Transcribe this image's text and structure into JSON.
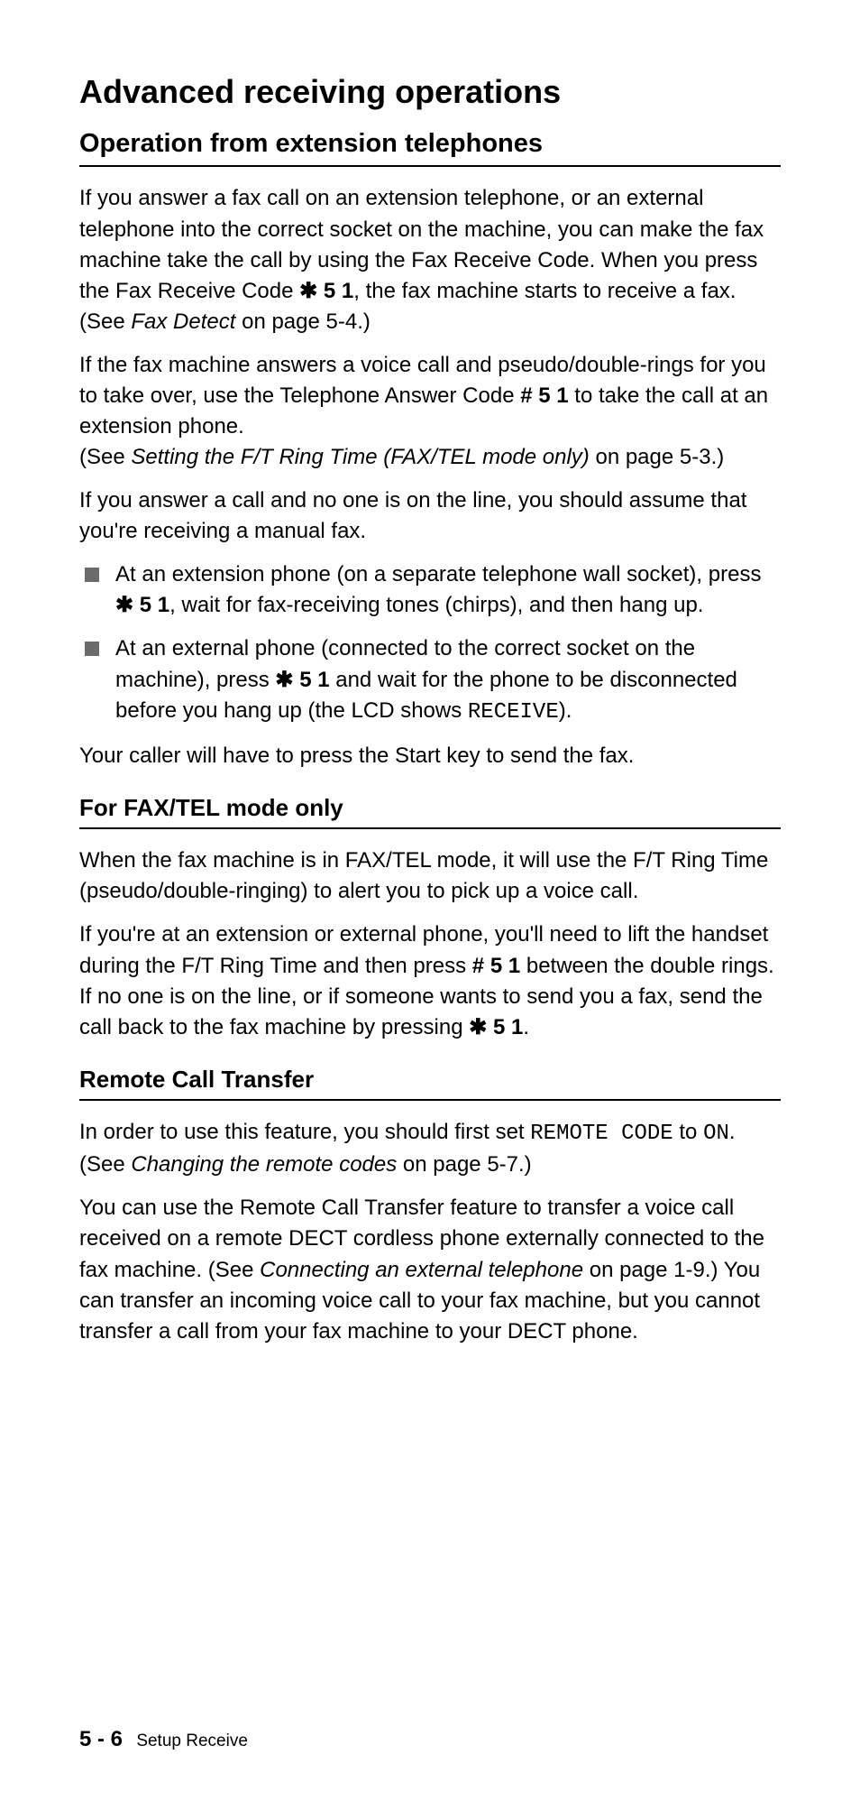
{
  "h1": "Advanced receiving operations",
  "sec1": {
    "title": "Operation from extension telephones",
    "p1a": "If you answer a fax call on an extension telephone, or an external telephone into the correct socket on the machine, you can make the fax machine take the call by using the Fax Receive Code. When you press the Fax Receive Code ",
    "code51": "5 1",
    "p1b": ", the fax machine starts to receive a fax. (See ",
    "p1ref": "Fax Detect",
    "p1c": " on page 5-4.)",
    "p2a": "If the fax machine answers a voice call and pseudo/double-rings for you to take over, use the Telephone Answer Code ",
    "hash51": "# 5 1",
    "p2b": " to take the call at an extension phone.",
    "p2see": "(See ",
    "p2ref": "Setting the F/T Ring Time (FAX/TEL mode only)",
    "p2c": " on page 5-3.)",
    "p3": "If you answer a call and no one is on the line, you should assume that you're receiving a manual fax.",
    "li1a": "At an extension phone (on a separate telephone wall socket), press ",
    "li1b": ", wait for fax-receiving tones (chirps), and then hang up.",
    "li2a": "At an external phone (connected to the correct socket on the machine), press ",
    "li2b": " and wait for the phone to be disconnected before you hang up (the LCD shows ",
    "li2mono": "RECEIVE",
    "li2c": ").",
    "p4": "Your caller will have to press the Start key to send the fax."
  },
  "sec2": {
    "title": "For FAX/TEL mode only",
    "p1": "When the fax machine is in FAX/TEL mode, it will use the F/T Ring Time (pseudo/double-ringing) to alert you to pick up a voice call.",
    "p2a": "If you're at an extension or external phone, you'll need to lift the handset during the F/T Ring Time and then press ",
    "hash51": "# 5 1",
    "p2b": " between the double rings. If no one is on the line, or if someone wants to send you a fax, send the call back to the fax machine by pressing ",
    "code51": "5 1",
    "p2c": "."
  },
  "sec3": {
    "title": "Remote Call Transfer",
    "p1a": "In order to use this feature, you should first set ",
    "mono1": "REMOTE CODE",
    "p1b": " to ",
    "mono2": "ON",
    "p1c": ". (See ",
    "p1ref": "Changing the remote codes",
    "p1d": " on page 5-7.)",
    "p2a": "You can use the Remote Call Transfer feature to transfer a voice call received on a remote DECT cordless phone externally connected to the fax machine. (See ",
    "p2ref": "Connecting an external telephone",
    "p2b": " on page 1-9.) You can transfer an incoming voice call to your fax machine, but you cannot transfer a call from your fax machine to your DECT phone."
  },
  "footer": {
    "page": "5 - 6",
    "section": "Setup Receive"
  },
  "glyph": {
    "star": "✱"
  }
}
